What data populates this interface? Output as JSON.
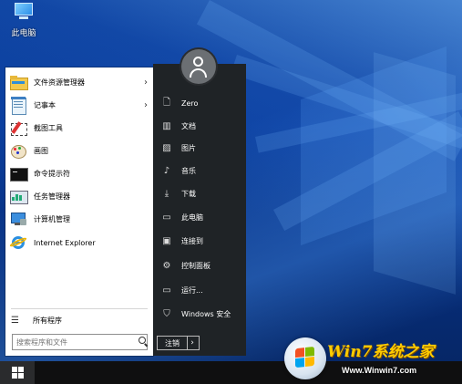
{
  "desktop": {
    "icon_label": "此电脑",
    "icon_name": "this-pc-icon"
  },
  "start_menu": {
    "programs": [
      {
        "label": "文件资源管理器",
        "icon": "file-explorer-icon",
        "has_submenu": true,
        "submenu_glyph": "›"
      },
      {
        "label": "记事本",
        "icon": "notepad-icon",
        "has_submenu": true,
        "submenu_glyph": "›"
      },
      {
        "label": "截图工具",
        "icon": "snipping-tool-icon",
        "has_submenu": false
      },
      {
        "label": "画图",
        "icon": "paint-icon",
        "has_submenu": false
      },
      {
        "label": "命令提示符",
        "icon": "command-prompt-icon",
        "has_submenu": false
      },
      {
        "label": "任务管理器",
        "icon": "task-manager-icon",
        "has_submenu": false
      },
      {
        "label": "计算机管理",
        "icon": "computer-management-icon",
        "has_submenu": false
      },
      {
        "label": "Internet Explorer",
        "icon": "internet-explorer-icon",
        "has_submenu": false
      }
    ],
    "all_programs": {
      "label": "所有程序",
      "icon": "all-programs-icon",
      "glyph": "☰"
    },
    "search": {
      "placeholder": "搜索程序和文件",
      "icon": "search-icon"
    },
    "right_items": [
      {
        "label": "Zero",
        "icon": "user-folder-icon",
        "glyph": "🗋"
      },
      {
        "label": "文档",
        "icon": "documents-icon",
        "glyph": "▥"
      },
      {
        "label": "图片",
        "icon": "pictures-icon",
        "glyph": "▨"
      },
      {
        "label": "音乐",
        "icon": "music-icon",
        "glyph": "♪"
      },
      {
        "label": "下载",
        "icon": "downloads-icon",
        "glyph": "⤓"
      },
      {
        "label": "此电脑",
        "icon": "this-pc-icon",
        "glyph": "▭"
      },
      {
        "label": "连接到",
        "icon": "connect-to-icon",
        "glyph": "▣"
      },
      {
        "label": "控制面板",
        "icon": "control-panel-icon",
        "glyph": "⚙"
      },
      {
        "label": "运行...",
        "icon": "run-icon",
        "glyph": "▭"
      },
      {
        "label": "Windows 安全",
        "icon": "windows-security-icon",
        "glyph": "⛉"
      }
    ],
    "logoff": {
      "label": "注销",
      "arrow": "›"
    },
    "avatar": {
      "icon": "user-avatar-icon"
    }
  },
  "taskbar": {
    "start_icon": "windows-logo-icon"
  },
  "watermark": {
    "title": "Win7系统之家",
    "url": "Www.Winwin7.com"
  }
}
